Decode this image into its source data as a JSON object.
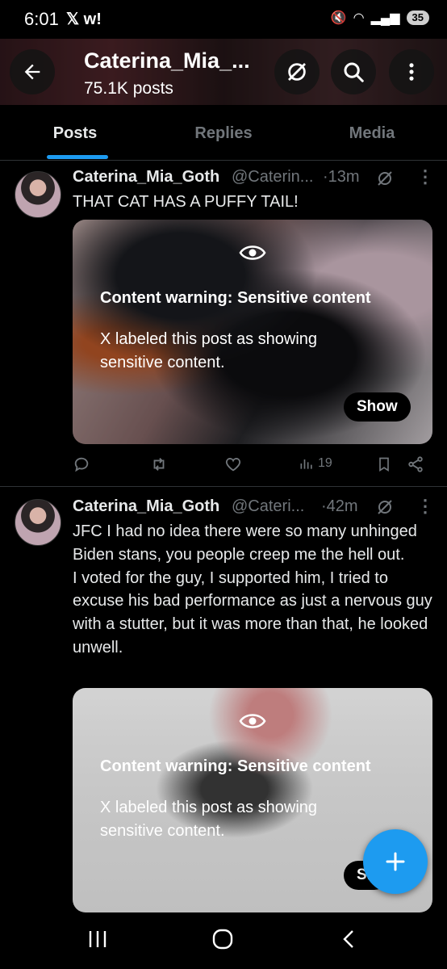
{
  "status_bar": {
    "time": "6:01",
    "left_icons": "𝕏 w!",
    "battery": "35"
  },
  "header": {
    "title": "Caterina_Mia_...",
    "subtitle": "75.1K posts"
  },
  "tabs": [
    {
      "label": "Posts",
      "active": true
    },
    {
      "label": "Replies",
      "active": false
    },
    {
      "label": "Media",
      "active": false
    }
  ],
  "posts": [
    {
      "name": "Caterina_Mia_Goth",
      "handle": "@Caterin...",
      "time": "·13m",
      "text": "THAT CAT HAS A PUFFY TAIL!",
      "warning_title": "Content warning: Sensitive content",
      "warning_desc": "X labeled this post as showing sensitive content.",
      "show_label": "Show",
      "views": "19"
    },
    {
      "name": "Caterina_Mia_Goth",
      "handle": "@Cateri...",
      "time": "·42m",
      "text": "JFC I had no idea there were so many unhinged Biden stans, you people creep me the hell out.\nI voted for the guy, I supported him, I tried to excuse his bad performance as just a nervous guy with a stutter, but it was more than that, he looked unwell.",
      "warning_title": "Content warning: Sensitive content",
      "warning_desc": "X labeled this post as showing sensitive content.",
      "show_label": "Sh"
    }
  ],
  "colors": {
    "accent": "#1d9bf0",
    "muted": "#71767b",
    "text": "#e7e9ea",
    "background": "#000000"
  }
}
